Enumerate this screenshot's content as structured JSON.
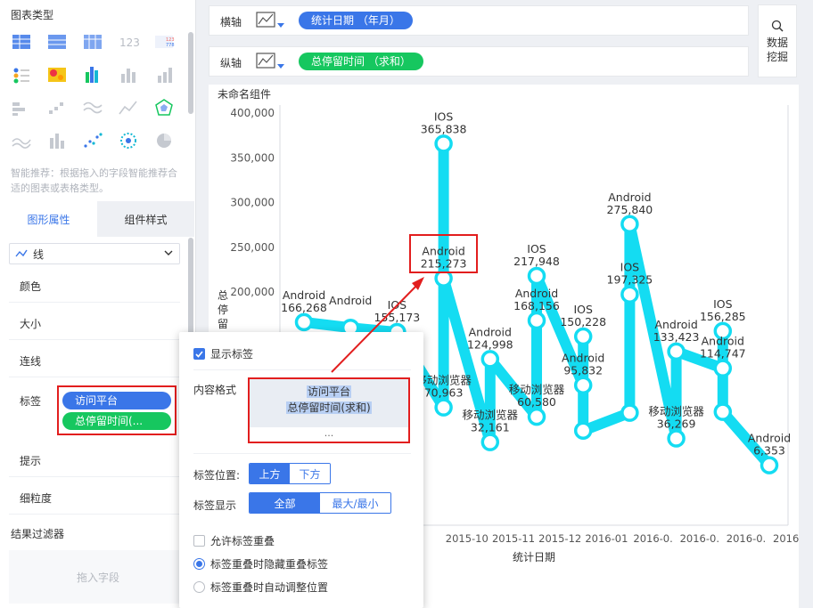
{
  "left_panel": {
    "chart_type_title": "图表类型",
    "recommend_hint": "智能推荐：根据拖入的字段智能推荐合适的图表或表格类型。",
    "tabs": [
      "图形属性",
      "组件样式"
    ],
    "chart_type_select": "线",
    "props": {
      "color": "颜色",
      "size": "大小",
      "connect": "连线",
      "label": "标签",
      "tooltip": "提示",
      "granularity": "细粒度"
    },
    "label_fields": [
      "访问平台",
      "总停留时间(..."
    ],
    "filter_title": "结果过滤器",
    "drop_hint": "拖入字段",
    "icon_grid": [
      "table-icon",
      "pivot-table-icon",
      "detail-table-icon",
      "number-123-icon",
      "kpi-card-icon",
      "dot-matrix-icon",
      "heatmap-icon",
      "multi-bar-icon",
      "grouped-bar-icon",
      "bar-chart-icon",
      "stacked-bar-icon",
      "scatter-step-icon",
      "wave-line-icon",
      "line-chart-icon",
      "radar-icon",
      "area-wave-icon",
      "column-chart-icon",
      "scatter-icon",
      "dotted-circle-icon",
      "pie-icon"
    ]
  },
  "axes": {
    "x_label": "横轴",
    "x_field": "统计日期 （年月）",
    "y_label": "纵轴",
    "y_field": "总停留时间 （求和）",
    "mining": [
      "数据",
      "挖掘"
    ]
  },
  "chart_title": "未命名组件",
  "popup": {
    "show_label": "显示标签",
    "content_format_label": "内容格式",
    "content_lines": [
      "访问平台",
      "总停留时间(求和)"
    ],
    "more": "...",
    "label_position_label": "标签位置:",
    "label_position_options": [
      "上方",
      "下方"
    ],
    "label_display_label": "标签显示",
    "label_display_options": [
      "全部",
      "最大/最小"
    ],
    "allow_overlap": "允许标签重叠",
    "radio_hide": "标签重叠时隐藏重叠标签",
    "radio_adjust": "标签重叠时自动调整位置"
  },
  "colors": {
    "accent": "#3a76e8",
    "green": "#16c75f",
    "line": "#14dcf2",
    "red": "#e21e1e"
  },
  "chart_data": {
    "type": "line",
    "title": "",
    "xlabel": "统计日期",
    "ylabel": "总停留时间",
    "ylim": [
      0,
      400000
    ],
    "y_ticks": [
      "400,000",
      "350,000",
      "300,000",
      "250,000",
      "200,000"
    ],
    "categories": [
      "",
      "",
      "",
      "",
      "2015-10",
      "2015-11",
      "2015-12",
      "2016-01",
      "2016-0.",
      "2016-0.",
      "2016-0.",
      "2016-0."
    ],
    "x_tick_labels": [
      "2015-10",
      "2015-11",
      "2015-12",
      "2016-01",
      "2016-0.",
      "2016-0.",
      "2016-0.",
      "2016-0."
    ],
    "points": [
      {
        "cat": 0,
        "y": 166268,
        "label": [
          "Android",
          "166,268"
        ]
      },
      {
        "cat": 1,
        "y": 160000,
        "label": [
          "Android",
          ""
        ]
      },
      {
        "cat": 2,
        "y": 155173,
        "label": [
          "IOS",
          "155,173"
        ]
      },
      {
        "cat": 3,
        "y": 365838,
        "label": [
          "IOS",
          "365,838"
        ]
      },
      {
        "cat": 3,
        "y": 215273,
        "label": [
          "Android",
          "215,273"
        ]
      },
      {
        "cat": 3,
        "y": 70963,
        "label": [
          "移动浏览器",
          "70,963"
        ]
      },
      {
        "cat": 4,
        "y": 124998,
        "label": [
          "Android",
          "124,998"
        ]
      },
      {
        "cat": 4,
        "y": 32161,
        "label": [
          "移动浏览器",
          "32,161"
        ]
      },
      {
        "cat": 5,
        "y": 217948,
        "label": [
          "IOS",
          "217,948"
        ]
      },
      {
        "cat": 5,
        "y": 168156,
        "label": [
          "Android",
          "168,156"
        ]
      },
      {
        "cat": 5,
        "y": 60580,
        "label": [
          "移动浏览器",
          "60,580"
        ]
      },
      {
        "cat": 6,
        "y": 150228,
        "label": [
          "IOS",
          "150,228"
        ]
      },
      {
        "cat": 6,
        "y": 95832,
        "label": [
          "Android",
          "95,832"
        ]
      },
      {
        "cat": 6,
        "y": 45000,
        "label": [
          "",
          ""
        ]
      },
      {
        "cat": 7,
        "y": 275840,
        "label": [
          "Android",
          "275,840"
        ]
      },
      {
        "cat": 7,
        "y": 197325,
        "label": [
          "IOS",
          "197,325"
        ]
      },
      {
        "cat": 7,
        "y": 65000,
        "label": [
          "",
          ""
        ]
      },
      {
        "cat": 8,
        "y": 133423,
        "label": [
          "Android",
          "133,423"
        ]
      },
      {
        "cat": 8,
        "y": 36269,
        "label": [
          "移动浏览器",
          "36,269"
        ]
      },
      {
        "cat": 9,
        "y": 156285,
        "label": [
          "IOS",
          "156,285"
        ]
      },
      {
        "cat": 9,
        "y": 114747,
        "label": [
          "Android",
          "114,747"
        ]
      },
      {
        "cat": 9,
        "y": 66000,
        "label": [
          "",
          ""
        ]
      },
      {
        "cat": 10,
        "y": 6353,
        "label": [
          "Android",
          "6,353"
        ]
      }
    ],
    "path_order": [
      0,
      1,
      2,
      5,
      3,
      4,
      7,
      6,
      10,
      9,
      8,
      12,
      11,
      13,
      16,
      15,
      14,
      18,
      17,
      20,
      19,
      21,
      22
    ],
    "grid": false,
    "legend": "none"
  }
}
